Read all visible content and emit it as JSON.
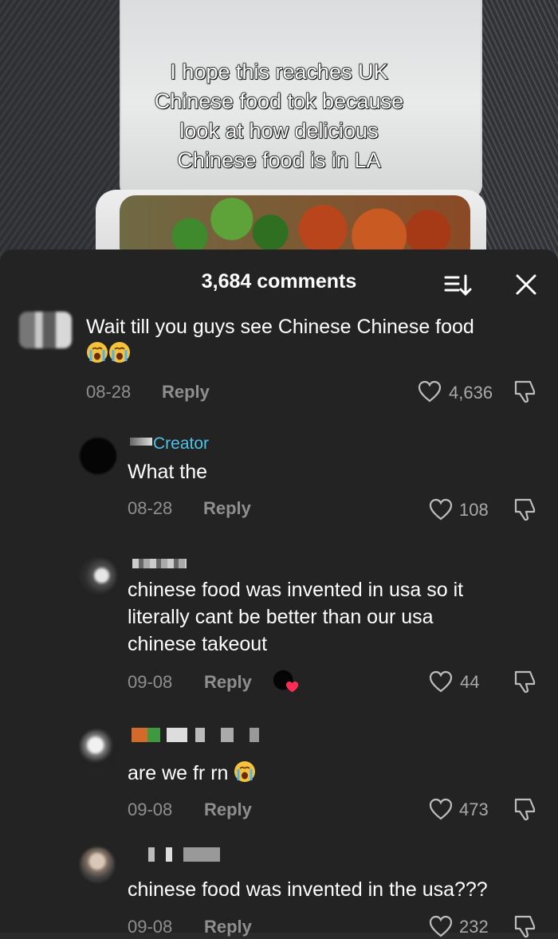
{
  "video": {
    "caption_lines": [
      "I hope this reaches UK",
      "Chinese food tok because",
      "look at how delicious",
      "Chinese food is in LA"
    ]
  },
  "comments_panel": {
    "count_label": "3,684 comments",
    "sort_icon": "sort-icon",
    "close_icon": "close-icon",
    "reply_label": "Reply",
    "comments": [
      {
        "text": "Wait till you guys see Chinese Chinese food",
        "emoji": [
          "loudly-crying-face",
          "loudly-crying-face"
        ],
        "date": "08-28",
        "likes": "4,636"
      },
      {
        "creator_label": "Creator",
        "text": "What the",
        "date": "08-28",
        "likes": "108"
      },
      {
        "text_lines": [
          "chinese food was invented in usa so it",
          "literally cant be better than our usa",
          "chinese takeout"
        ],
        "date": "09-08",
        "likes": "44",
        "creator_liked_icon": "creator-liked-heart-icon"
      },
      {
        "text": "are we fr rn",
        "emoji": [
          "loudly-crying-face"
        ],
        "date": "09-08",
        "likes": "473"
      },
      {
        "text": "chinese food was invented in the usa???",
        "date": "09-08",
        "likes": "232"
      }
    ]
  },
  "colors": {
    "sheet_bg": "#232323",
    "creator_accent": "#4dc2e6",
    "muted_text": "#8f8f8f"
  }
}
